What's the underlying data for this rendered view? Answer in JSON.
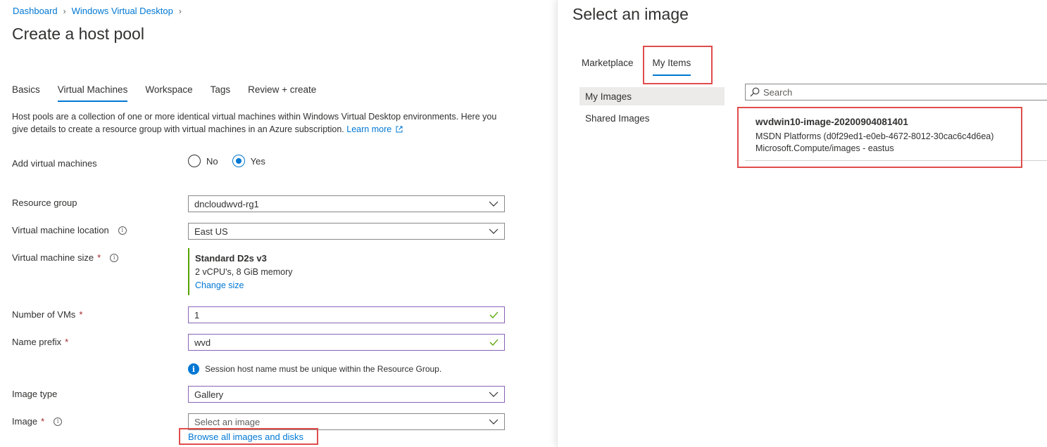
{
  "breadcrumb": {
    "items": [
      "Dashboard",
      "Windows Virtual Desktop"
    ]
  },
  "page_title": "Create a host pool",
  "tabs": [
    "Basics",
    "Virtual Machines",
    "Workspace",
    "Tags",
    "Review + create"
  ],
  "active_tab": "Virtual Machines",
  "description": {
    "text": "Host pools are a collection of one or more identical virtual machines within Windows Virtual Desktop environments. Here you give details to create a resource group with virtual machines in an Azure subscription.",
    "link": "Learn more"
  },
  "form": {
    "add_vms": {
      "label": "Add virtual machines",
      "options": [
        "No",
        "Yes"
      ],
      "selected": "Yes"
    },
    "resource_group": {
      "label": "Resource group",
      "value": "dncloudwvd-rg1"
    },
    "vm_location": {
      "label": "Virtual machine location",
      "value": "East US"
    },
    "vm_size": {
      "label": "Virtual machine size",
      "name": "Standard D2s v3",
      "spec": "2 vCPU's, 8 GiB memory",
      "change_link": "Change size"
    },
    "num_vms": {
      "label": "Number of VMs",
      "value": "1"
    },
    "name_prefix": {
      "label": "Name prefix",
      "value": "wvd"
    },
    "info_message": "Session host name must be unique within the Resource Group.",
    "image_type": {
      "label": "Image type",
      "value": "Gallery"
    },
    "image": {
      "label": "Image",
      "placeholder": "Select an image",
      "browse_link": "Browse all images and disks"
    },
    "required_marker": "*"
  },
  "image_panel": {
    "title": "Select an image",
    "tabs": [
      "Marketplace",
      "My Items"
    ],
    "active_tab": "My Items",
    "nav": [
      "My Images",
      "Shared Images"
    ],
    "selected_nav": "My Images",
    "search_placeholder": "Search",
    "images": [
      {
        "name": "wvdwin10-image-20200904081401",
        "subscription": "MSDN Platforms (d0f29ed1-e0eb-4672-8012-30cac6c4d6ea)",
        "type_location": "Microsoft.Compute/images - eastus"
      }
    ]
  },
  "colors": {
    "link": "#0078d4",
    "highlight_box": "#e04c4c",
    "valid_border": "#8764b8",
    "valid_check": "#57a300",
    "required": "#a4262c"
  }
}
